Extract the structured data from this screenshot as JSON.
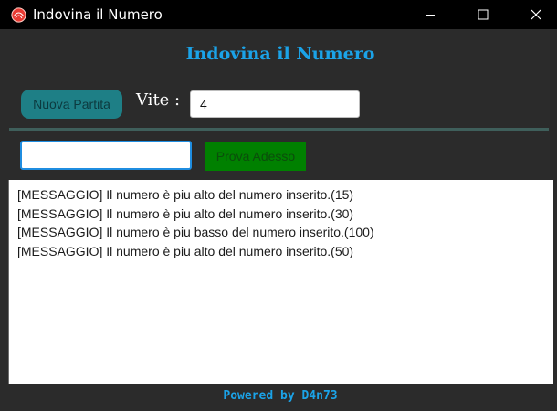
{
  "window": {
    "title": "Indovina il Numero",
    "icon": "red-shell-icon"
  },
  "header": {
    "title": "Indovina il Numero"
  },
  "controls": {
    "new_game_label": "Nuova Partita",
    "lives_label": "Vite :",
    "lives_value": "4",
    "guess_value": "",
    "try_label": "Prova Adesso"
  },
  "log": {
    "lines": [
      "[MESSAGGIO] Il numero è piu alto del numero inserito.(15)",
      "[MESSAGGIO] Il numero è piu alto del numero inserito.(30)",
      "[MESSAGGIO] Il numero è piu basso del numero inserito.(100)",
      "[MESSAGGIO] Il numero è piu alto del numero inserito.(50)"
    ]
  },
  "footer": {
    "text": "Powered by D4n73"
  },
  "colors": {
    "accent": "#1ba3e8",
    "new_game_bg": "#1e7f86",
    "try_bg": "#008000",
    "background": "#2b2b2b"
  }
}
